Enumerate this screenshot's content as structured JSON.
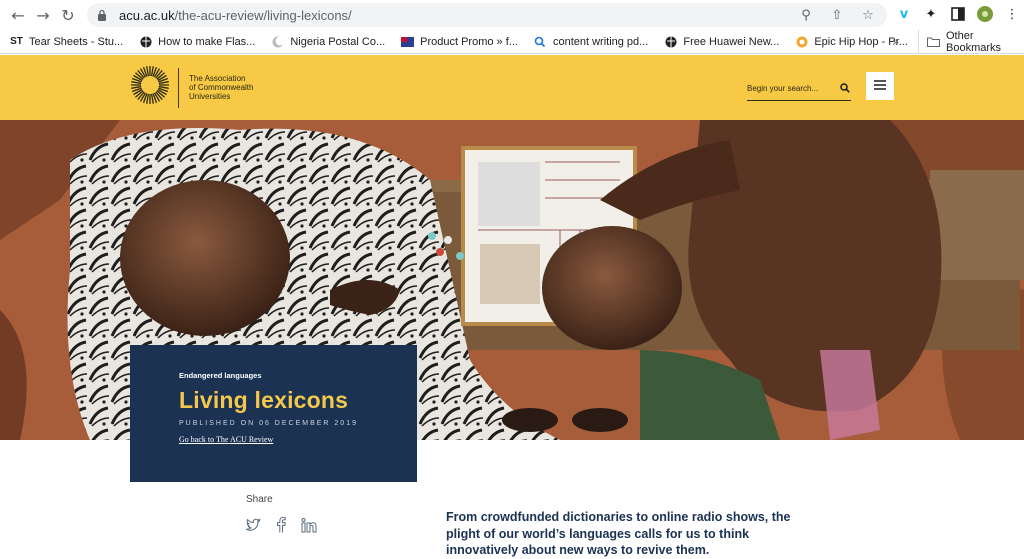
{
  "browser": {
    "url_domain": "acu.ac.uk",
    "url_path": "/the-acu-review/living-lexicons/",
    "back_icon": "back-arrow-icon",
    "forward_icon": "forward-arrow-icon",
    "reload_icon": "reload-icon"
  },
  "bookmarks": [
    {
      "label": "Tear Sheets - Stu...",
      "icon": "ST"
    },
    {
      "label": "How to make Flas...",
      "icon": "globe-icon"
    },
    {
      "label": "Nigeria Postal Co...",
      "icon": "moon-icon"
    },
    {
      "label": "Product Promo » f...",
      "icon": "flag-icon"
    },
    {
      "label": "content writing pd...",
      "icon": "search-icon"
    },
    {
      "label": "Free Huawei New...",
      "icon": "globe-icon"
    },
    {
      "label": "Epic Hip Hop - Pr...",
      "icon": "circle-icon"
    }
  ],
  "bookmarks_more": "»",
  "bookmarks_other": "Other Bookmarks",
  "header": {
    "logo_text": [
      "The Association",
      "of Commonwealth",
      "Universities"
    ],
    "search_placeholder": "Begin your search...",
    "accent": "#f7c945"
  },
  "article": {
    "category": "Endangered languages",
    "title": "Living lexicons",
    "published": "PUBLISHED ON 06 DECEMBER 2019",
    "back_link": "Go back to The ACU Review",
    "card_color": "#1b3253",
    "title_color": "#f4c84b"
  },
  "share": {
    "label": "Share",
    "icons": [
      "twitter-icon",
      "facebook-icon",
      "linkedin-icon"
    ]
  },
  "lede": "From crowdfunded dictionaries to online radio shows, the plight of our world’s languages calls for us to think innovatively about new ways to revive them."
}
